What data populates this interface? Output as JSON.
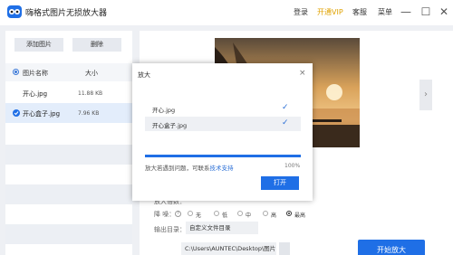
{
  "app": {
    "title": "嗨格式图片无损放大器",
    "menu": {
      "login": "登录",
      "vip": "开通VIP",
      "service": "客服",
      "menu": "菜单"
    }
  },
  "left_panel": {
    "add_button": "添加图片",
    "delete_button": "删除",
    "columns": {
      "name": "图片名称",
      "size": "大小"
    },
    "files": [
      {
        "name": "开心.jpg",
        "size": "11.88 KB",
        "selected": false
      },
      {
        "name": "开心盒子.jpg",
        "size": "7.96 KB",
        "selected": true
      }
    ]
  },
  "settings": {
    "denoise_label": "降 噪：",
    "denoise_options": [
      "无",
      "低",
      "中",
      "高",
      "最高"
    ],
    "denoise_selected": "最高",
    "output_label": "输出目录：",
    "custom_dir": "自定义文件目录",
    "path": "C:\\Users\\AUNTEC\\Desktop\\图片\\",
    "start_button": "开始放大"
  },
  "dialog": {
    "title": "放大",
    "close": "×",
    "items": [
      "开心.jpg",
      "开心盒子.jpg"
    ],
    "progress": 1.0,
    "message": "放大若遇到问题，可联系",
    "message_link": "技术支持",
    "percent": "100%",
    "open_button": "打开"
  },
  "colors": {
    "accent": "#1f6fe6",
    "vip": "#e0a200"
  }
}
